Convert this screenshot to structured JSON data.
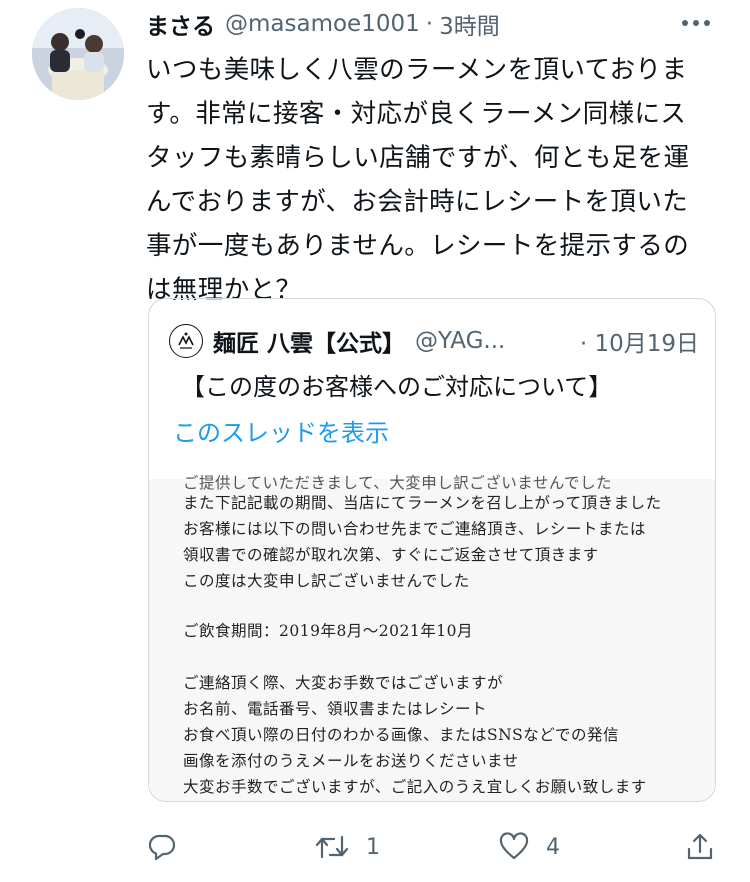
{
  "tweet": {
    "display_name": "まさる",
    "handle": "@masamoe1001",
    "separator": "·",
    "time": "3時間",
    "text": "いつも美味しく八雲のラーメンを頂いておりま\nす。非常に接客・対応が良くラーメン同様にス\nタッフも素晴らしい店舗ですが、何とも足を運\nんでおりますが、お会計時にレシートを頂いた\n事が一度もありません。レシートを提示するの\nは無理かと？"
  },
  "quoted": {
    "display_name": "麺匠 八雲【公式】",
    "handle": "@YAG...",
    "separator": "·",
    "time": "10月19日",
    "text": "【この度のお客様へのご対応について】",
    "thread_link": "このスレッドを表示",
    "image_lines": [
      "ご提供していただきまして、大変申し訳ございませんでした",
      "また下記記載の期間、当店にてラーメンを召し上がって頂きました",
      "お客様には以下の問い合わせ先までご連絡頂き、レシートまたは",
      "領収書での確認が取れ次第、すぐにご返金させて頂きます",
      "この度は大変申し訳ございませんでした",
      "",
      "ご飲食期間：2019年8月〜2021年10月",
      "",
      "ご連絡頂く際、大変お手数ではございますが",
      "お名前、電話番号、領収書またはレシート",
      "お食べ頂い際の日付のわかる画像、またはSNSなどでの発信",
      "画像を添付のうえメールをお送りくださいませ",
      "大変お手数でございますが、ご記入のうえ宜しくお願い致します"
    ]
  },
  "actions": {
    "retweet_count": "1",
    "like_count": "4"
  },
  "colors": {
    "link": "#1d9bf0",
    "secondary": "#536471",
    "border": "#cfd9de"
  }
}
